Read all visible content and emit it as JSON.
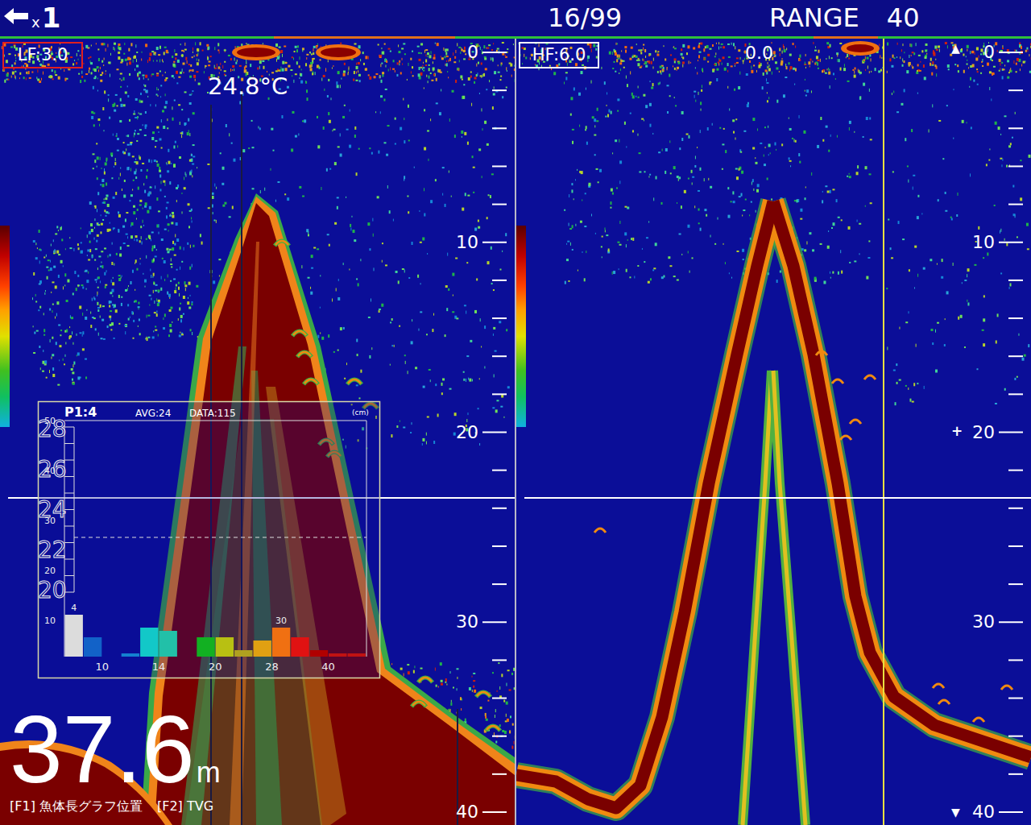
{
  "top_bar": {
    "zoom_prefix": "x",
    "zoom": "1",
    "page": "16/99",
    "range_label": "RANGE",
    "range_value": "40"
  },
  "panels": [
    {
      "kind": "lf",
      "label": "LF:3.0",
      "selected": true,
      "scale": [
        "0",
        "10",
        "20",
        "30",
        "40"
      ],
      "temperature": "24.8°C",
      "fish_length_graph": {
        "title": "P1:4",
        "avg": "AVG:24",
        "data": "DATA:115",
        "unit": "(cm)",
        "count_ticks": [
          "50",
          "40",
          "30",
          "20",
          "10"
        ],
        "temp_ticks": [
          "28",
          "26",
          "24",
          "22",
          "20"
        ],
        "bars": [
          {
            "value": 13,
            "color": "#dcdcdc",
            "label": "4"
          },
          {
            "value": 6,
            "color": "#1262c8"
          },
          {
            "value": 0,
            "color": "#1040c0",
            "tick": "10"
          },
          {
            "value": 1,
            "color": "#1480d0"
          },
          {
            "value": 9,
            "color": "#12c8c8"
          },
          {
            "value": 8,
            "color": "#22c0a8",
            "tick": "14"
          },
          {
            "value": 0,
            "color": "#20a060"
          },
          {
            "value": 6,
            "color": "#12b022"
          },
          {
            "value": 6,
            "color": "#b8c012",
            "tick": "20"
          },
          {
            "value": 2,
            "color": "#b0a020"
          },
          {
            "value": 5,
            "color": "#e0a012"
          },
          {
            "value": 9,
            "color": "#f07012",
            "label": "30",
            "tick": "28"
          },
          {
            "value": 6,
            "color": "#e01212"
          },
          {
            "value": 2,
            "color": "#b00000"
          },
          {
            "value": 1,
            "color": "#c01212",
            "tick": "40"
          },
          {
            "value": 1,
            "color": "#c01212"
          }
        ]
      },
      "depth": {
        "value": "37.6",
        "unit": "m"
      },
      "footer": [
        "[F1] 魚体長グラフ位置",
        "[F2] TVG"
      ]
    },
    {
      "kind": "hf",
      "label": "HF:6.0",
      "selected": false,
      "scale": [
        "0",
        "10",
        "20",
        "30",
        "40"
      ],
      "offset": "0.0",
      "markers": {
        "top": "▲",
        "bottom": "▼",
        "cursor": "+"
      }
    }
  ]
}
